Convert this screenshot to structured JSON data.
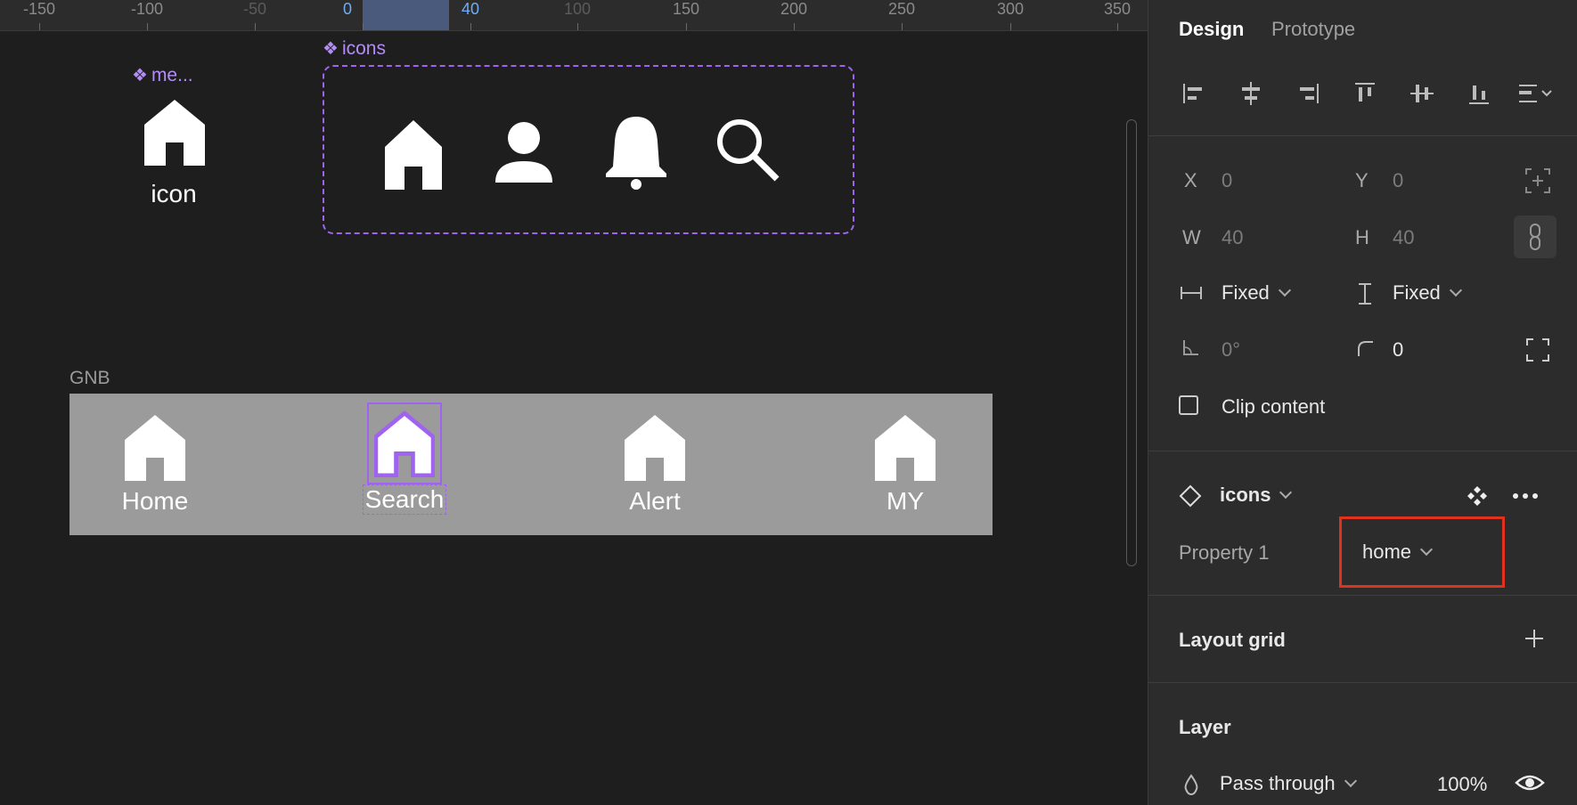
{
  "ruler": {
    "ticks": [
      "-150",
      "-100",
      "-50",
      "0",
      "40",
      "100",
      "150",
      "200",
      "250",
      "300",
      "350"
    ]
  },
  "canvas": {
    "master_component_label": "me...",
    "master_icon_label": "icon",
    "icons_component_label": "icons",
    "gnb_label": "GNB",
    "gnb_items": [
      "Home",
      "Search",
      "Alert",
      "MY"
    ],
    "colors": {
      "selection": "#9f63f0",
      "gnb_bg": "#9b9b9b",
      "component": "#b38cf5"
    }
  },
  "panel": {
    "tabs": [
      "Design",
      "Prototype"
    ],
    "x_label": "X",
    "x_value": "0",
    "y_label": "Y",
    "y_value": "0",
    "w_label": "W",
    "w_value": "40",
    "h_label": "H",
    "h_value": "40",
    "width_mode": "Fixed",
    "height_mode": "Fixed",
    "rotation": "0°",
    "corner_radius": "0",
    "clip_content": "Clip content",
    "instance_name": "icons",
    "property_label": "Property 1",
    "property_value": "home",
    "layout_grid": "Layout grid",
    "layer_title": "Layer",
    "blend_mode": "Pass through",
    "opacity": "100%"
  }
}
